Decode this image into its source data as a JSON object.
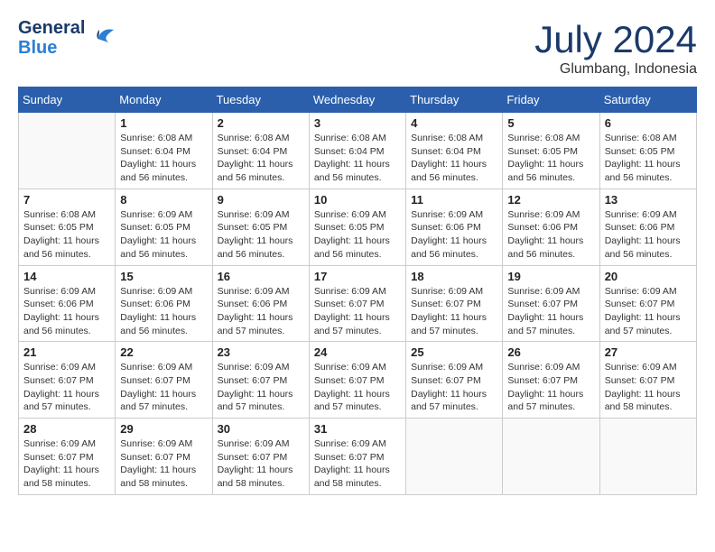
{
  "header": {
    "logo_line1": "General",
    "logo_line2": "Blue",
    "month_year": "July 2024",
    "location": "Glumbang, Indonesia"
  },
  "weekdays": [
    "Sunday",
    "Monday",
    "Tuesday",
    "Wednesday",
    "Thursday",
    "Friday",
    "Saturday"
  ],
  "weeks": [
    [
      {
        "day": "",
        "info": ""
      },
      {
        "day": "1",
        "info": "Sunrise: 6:08 AM\nSunset: 6:04 PM\nDaylight: 11 hours\nand 56 minutes."
      },
      {
        "day": "2",
        "info": "Sunrise: 6:08 AM\nSunset: 6:04 PM\nDaylight: 11 hours\nand 56 minutes."
      },
      {
        "day": "3",
        "info": "Sunrise: 6:08 AM\nSunset: 6:04 PM\nDaylight: 11 hours\nand 56 minutes."
      },
      {
        "day": "4",
        "info": "Sunrise: 6:08 AM\nSunset: 6:04 PM\nDaylight: 11 hours\nand 56 minutes."
      },
      {
        "day": "5",
        "info": "Sunrise: 6:08 AM\nSunset: 6:05 PM\nDaylight: 11 hours\nand 56 minutes."
      },
      {
        "day": "6",
        "info": "Sunrise: 6:08 AM\nSunset: 6:05 PM\nDaylight: 11 hours\nand 56 minutes."
      }
    ],
    [
      {
        "day": "7",
        "info": "Sunrise: 6:08 AM\nSunset: 6:05 PM\nDaylight: 11 hours\nand 56 minutes."
      },
      {
        "day": "8",
        "info": "Sunrise: 6:09 AM\nSunset: 6:05 PM\nDaylight: 11 hours\nand 56 minutes."
      },
      {
        "day": "9",
        "info": "Sunrise: 6:09 AM\nSunset: 6:05 PM\nDaylight: 11 hours\nand 56 minutes."
      },
      {
        "day": "10",
        "info": "Sunrise: 6:09 AM\nSunset: 6:05 PM\nDaylight: 11 hours\nand 56 minutes."
      },
      {
        "day": "11",
        "info": "Sunrise: 6:09 AM\nSunset: 6:06 PM\nDaylight: 11 hours\nand 56 minutes."
      },
      {
        "day": "12",
        "info": "Sunrise: 6:09 AM\nSunset: 6:06 PM\nDaylight: 11 hours\nand 56 minutes."
      },
      {
        "day": "13",
        "info": "Sunrise: 6:09 AM\nSunset: 6:06 PM\nDaylight: 11 hours\nand 56 minutes."
      }
    ],
    [
      {
        "day": "14",
        "info": "Sunrise: 6:09 AM\nSunset: 6:06 PM\nDaylight: 11 hours\nand 56 minutes."
      },
      {
        "day": "15",
        "info": "Sunrise: 6:09 AM\nSunset: 6:06 PM\nDaylight: 11 hours\nand 56 minutes."
      },
      {
        "day": "16",
        "info": "Sunrise: 6:09 AM\nSunset: 6:06 PM\nDaylight: 11 hours\nand 57 minutes."
      },
      {
        "day": "17",
        "info": "Sunrise: 6:09 AM\nSunset: 6:07 PM\nDaylight: 11 hours\nand 57 minutes."
      },
      {
        "day": "18",
        "info": "Sunrise: 6:09 AM\nSunset: 6:07 PM\nDaylight: 11 hours\nand 57 minutes."
      },
      {
        "day": "19",
        "info": "Sunrise: 6:09 AM\nSunset: 6:07 PM\nDaylight: 11 hours\nand 57 minutes."
      },
      {
        "day": "20",
        "info": "Sunrise: 6:09 AM\nSunset: 6:07 PM\nDaylight: 11 hours\nand 57 minutes."
      }
    ],
    [
      {
        "day": "21",
        "info": "Sunrise: 6:09 AM\nSunset: 6:07 PM\nDaylight: 11 hours\nand 57 minutes."
      },
      {
        "day": "22",
        "info": "Sunrise: 6:09 AM\nSunset: 6:07 PM\nDaylight: 11 hours\nand 57 minutes."
      },
      {
        "day": "23",
        "info": "Sunrise: 6:09 AM\nSunset: 6:07 PM\nDaylight: 11 hours\nand 57 minutes."
      },
      {
        "day": "24",
        "info": "Sunrise: 6:09 AM\nSunset: 6:07 PM\nDaylight: 11 hours\nand 57 minutes."
      },
      {
        "day": "25",
        "info": "Sunrise: 6:09 AM\nSunset: 6:07 PM\nDaylight: 11 hours\nand 57 minutes."
      },
      {
        "day": "26",
        "info": "Sunrise: 6:09 AM\nSunset: 6:07 PM\nDaylight: 11 hours\nand 57 minutes."
      },
      {
        "day": "27",
        "info": "Sunrise: 6:09 AM\nSunset: 6:07 PM\nDaylight: 11 hours\nand 58 minutes."
      }
    ],
    [
      {
        "day": "28",
        "info": "Sunrise: 6:09 AM\nSunset: 6:07 PM\nDaylight: 11 hours\nand 58 minutes."
      },
      {
        "day": "29",
        "info": "Sunrise: 6:09 AM\nSunset: 6:07 PM\nDaylight: 11 hours\nand 58 minutes."
      },
      {
        "day": "30",
        "info": "Sunrise: 6:09 AM\nSunset: 6:07 PM\nDaylight: 11 hours\nand 58 minutes."
      },
      {
        "day": "31",
        "info": "Sunrise: 6:09 AM\nSunset: 6:07 PM\nDaylight: 11 hours\nand 58 minutes."
      },
      {
        "day": "",
        "info": ""
      },
      {
        "day": "",
        "info": ""
      },
      {
        "day": "",
        "info": ""
      }
    ]
  ]
}
